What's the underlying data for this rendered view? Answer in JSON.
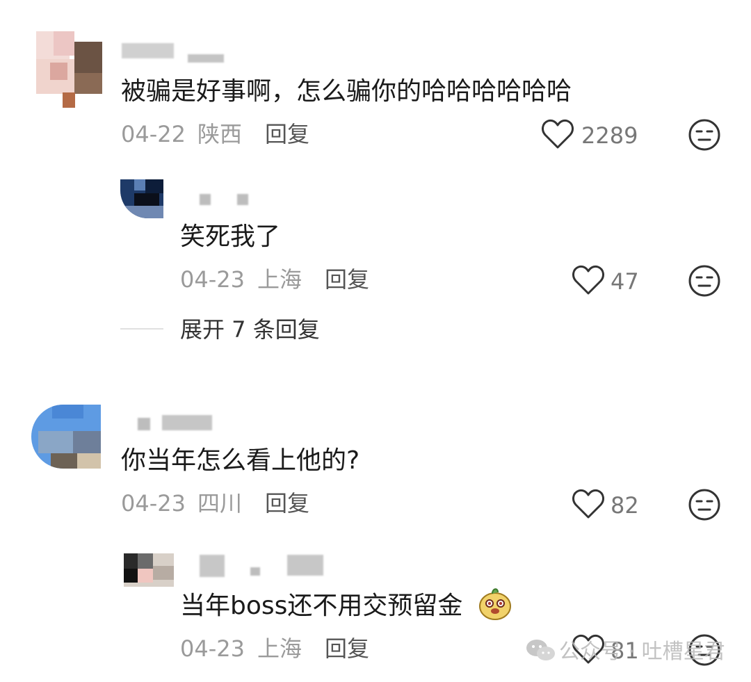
{
  "comments": [
    {
      "text": "被骗是好事啊，怎么骗你的哈哈哈哈哈哈",
      "date": "04-22",
      "location": "陕西",
      "reply_label": "回复",
      "likes": "2289"
    },
    {
      "text": "笑死我了",
      "date": "04-23",
      "location": "上海",
      "reply_label": "回复",
      "likes": "47"
    },
    {
      "text": "你当年怎么看上他的?",
      "date": "04-23",
      "location": "四川",
      "reply_label": "回复",
      "likes": "82"
    },
    {
      "text": "当年boss还不用交预留金",
      "date": "04-23",
      "location": "上海",
      "reply_label": "回复",
      "likes": "81"
    }
  ],
  "expand_replies": "展开 7 条回复",
  "watermark": "公众号 · 吐槽星君",
  "icons": [
    "heart-icon",
    "meh-face-icon",
    "wechat-icon",
    "emoji-sticker-icon"
  ]
}
